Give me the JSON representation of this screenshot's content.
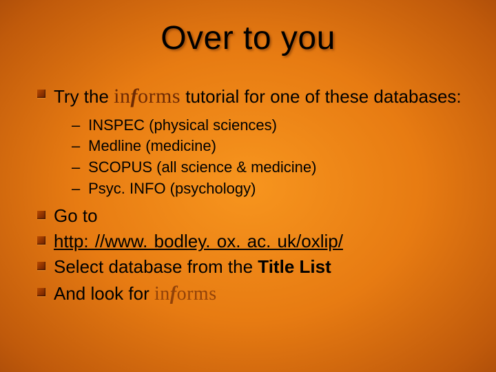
{
  "title": "Over to you",
  "bullets": {
    "b1_pre": "Try the ",
    "b1_post": " tutorial for one of these databases:",
    "sub": [
      "INSPEC (physical sciences)",
      "Medline (medicine)",
      "SCOPUS (all science & medicine)",
      "Psyc. INFO (psychology)"
    ],
    "b2": "Go to",
    "b3_link": "http: //www. bodley. ox. ac. uk/oxlip/",
    "b4_pre": "Select database from the ",
    "b4_bold": "Title List",
    "b5": "And look for "
  },
  "logo": {
    "in": "in",
    "f": "f",
    "orms": "orms"
  },
  "dash": "–"
}
